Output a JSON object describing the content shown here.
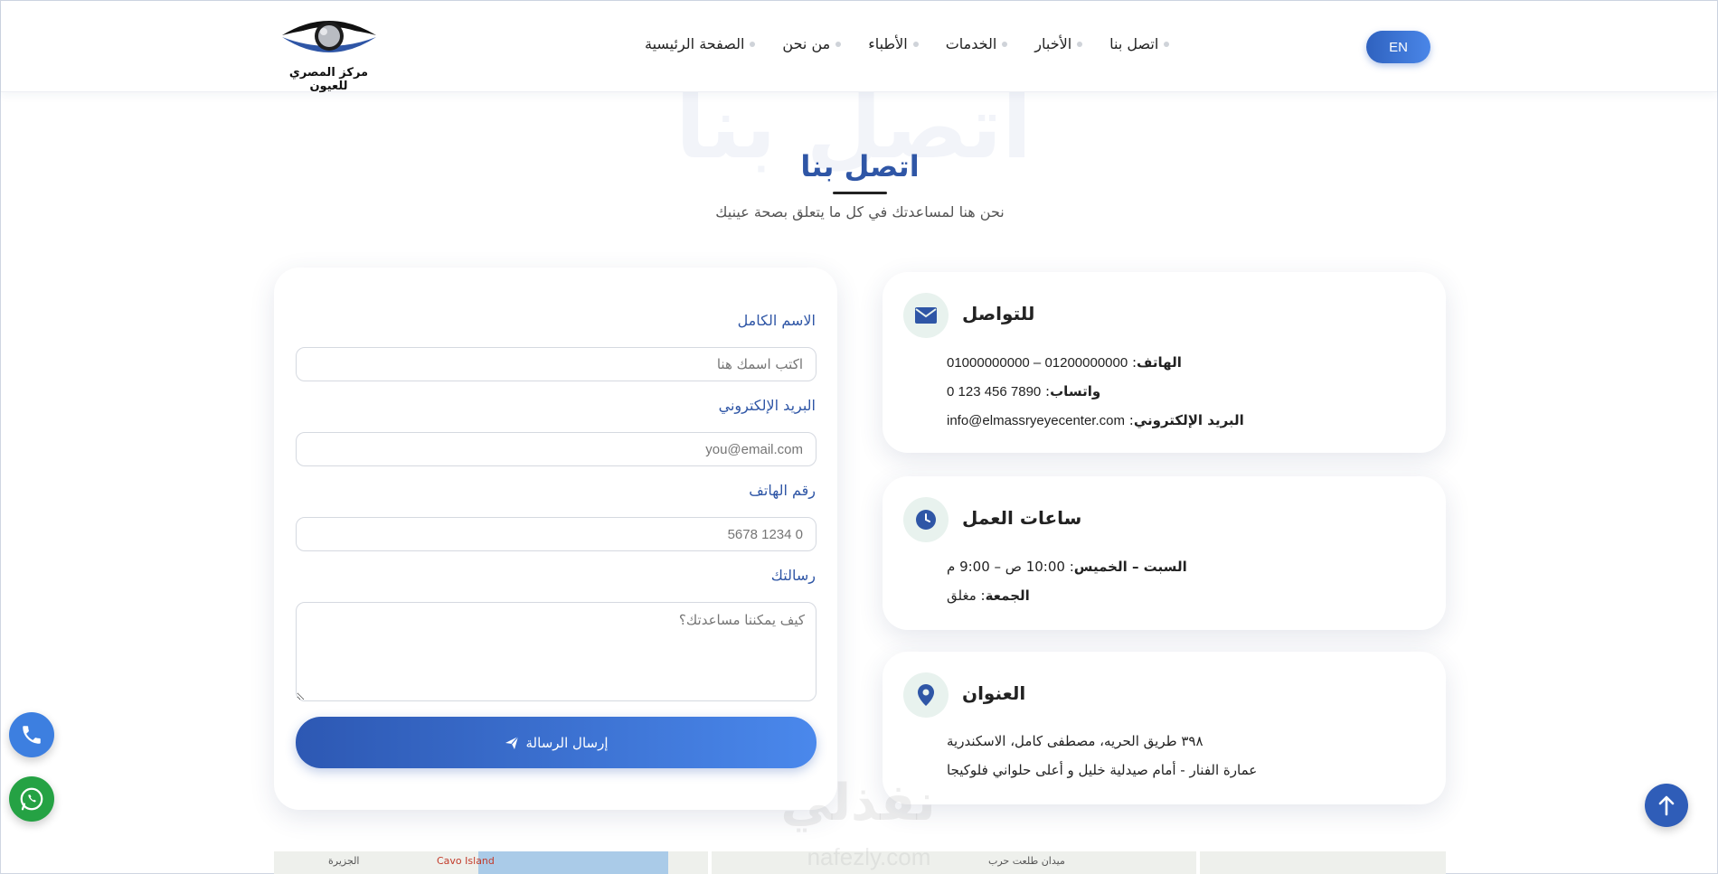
{
  "header": {
    "logo_text": "مركز المصري للعيون",
    "nav": [
      {
        "label": "الصفحة الرئيسية"
      },
      {
        "label": "من نحن"
      },
      {
        "label": "الأطباء"
      },
      {
        "label": "الخدمات"
      },
      {
        "label": "الأخبار"
      },
      {
        "label": "اتصل بنا"
      }
    ],
    "lang_button": "EN"
  },
  "hero": {
    "ghost_title": "اتصل بنا",
    "title": "اتصل بنا",
    "subtitle": "نحن هنا لمساعدتك في كل ما يتعلق بصحة عينيك"
  },
  "form": {
    "name_label": "الاسم الكامل",
    "name_placeholder": "اكتب اسمك هنا",
    "email_label": "البريد الإلكتروني",
    "email_placeholder": "you@email.com",
    "phone_label": "رقم الهاتف",
    "phone_placeholder": "0 1234 5678",
    "message_label": "رسالتك",
    "message_placeholder": "كيف يمكننا مساعدتك؟",
    "submit_label": "إرسال الرسالة"
  },
  "contact_card": {
    "title": "للتواصل",
    "phone_label": "الهاتف",
    "phone_value": "01000000000 – 01200000000",
    "whatsapp_label": "واتساب",
    "whatsapp_value": "0 123 456 7890",
    "email_label": "البريد الإلكتروني",
    "email_value": "info@elmassryeyecenter.com"
  },
  "hours_card": {
    "title": "ساعات العمل",
    "weekday_label": "السبت – الخميس",
    "weekday_value": "10:00 ص – 9:00 م",
    "friday_label": "الجمعة",
    "friday_value": "مغلق"
  },
  "address_card": {
    "title": "العنوان",
    "line1": "٣٩٨ طريق الحريه، مصطفى كامل، الاسكندرية",
    "line2": "عمارة الفنار - أمام صيدلية خليل و أعلى حلواني فلوكيجا"
  },
  "map": {
    "label_island": "الجزيرة",
    "label_cavo": "Cavo Island",
    "label_square": "ميدان طلعت حرب"
  },
  "watermark": {
    "text": "نفذلي",
    "sub": "nafezly.com"
  },
  "colors": {
    "primary": "#2f56a6",
    "accent": "#4a86e8",
    "whatsapp": "#25a244"
  }
}
